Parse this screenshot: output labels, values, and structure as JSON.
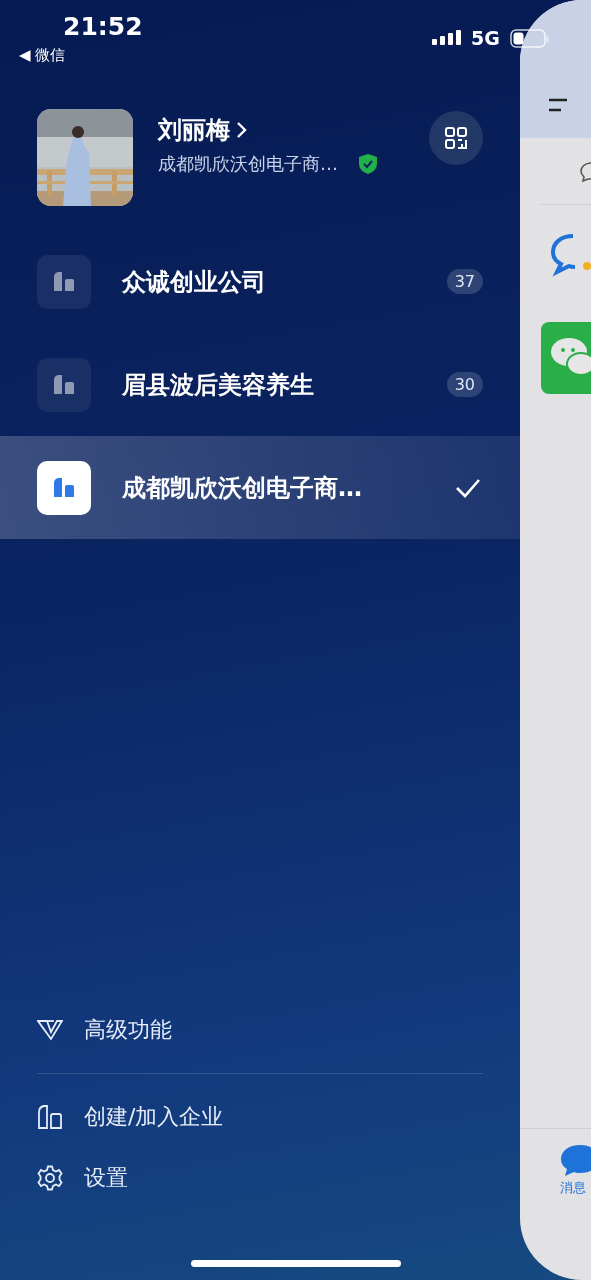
{
  "status_bar": {
    "time": "21:52",
    "back_label": "◀ 微信",
    "network": "5G"
  },
  "profile": {
    "name": "刘丽梅",
    "company": "成都凯欣沃创电子商…",
    "verified": true
  },
  "companies": [
    {
      "name": "众诚创业公司",
      "badge": "37",
      "selected": false
    },
    {
      "name": "眉县波后美容养生",
      "badge": "30",
      "selected": false
    },
    {
      "name": "成都凯欣沃创电子商…",
      "selected": true
    }
  ],
  "menu": [
    {
      "kind": "premium",
      "label": "高级功能"
    },
    {
      "kind": "create",
      "label": "创建/加入企业"
    },
    {
      "kind": "settings",
      "label": "设置"
    }
  ],
  "main_panel": {
    "tab_label": "消息"
  }
}
